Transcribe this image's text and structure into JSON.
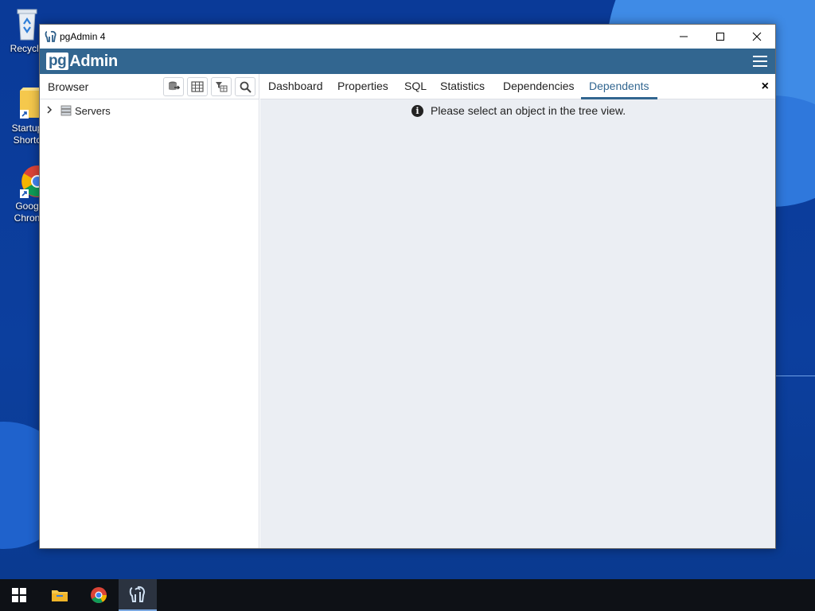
{
  "desktop": {
    "icons": [
      {
        "label": "Recycle",
        "icon": "recycle-bin-icon"
      },
      {
        "label": "Startup\nShortc",
        "icon": "folder-shortcut-icon"
      },
      {
        "label": "Goog\nChron",
        "icon": "chrome-icon"
      }
    ]
  },
  "window": {
    "title": "pgAdmin 4",
    "controls": {
      "minimize": "minimize-icon",
      "maximize": "maximize-icon",
      "close": "close-icon"
    }
  },
  "brand": {
    "pg": "pg",
    "admin": "Admin"
  },
  "browser": {
    "label": "Browser",
    "toolbar": [
      "query-tool-icon",
      "view-data-icon",
      "filter-rows-icon",
      "search-objects-icon"
    ],
    "tree": [
      {
        "label": "Servers",
        "icon": "servers-icon"
      }
    ]
  },
  "tabs": [
    {
      "label": "Dashboard"
    },
    {
      "label": "Properties"
    },
    {
      "label": "SQL"
    },
    {
      "label": "Statistics"
    },
    {
      "label": "Dependencies"
    },
    {
      "label": "Dependents",
      "active": true
    }
  ],
  "close_tab": "×",
  "message": "Please select an object in the tree view.",
  "info_glyph": "i",
  "taskbar": [
    "windows-start-icon",
    "file-explorer-icon",
    "chrome-icon",
    "pgadmin-icon"
  ],
  "colors": {
    "brand": "#326690",
    "panel_bg": "#ebeef3"
  }
}
